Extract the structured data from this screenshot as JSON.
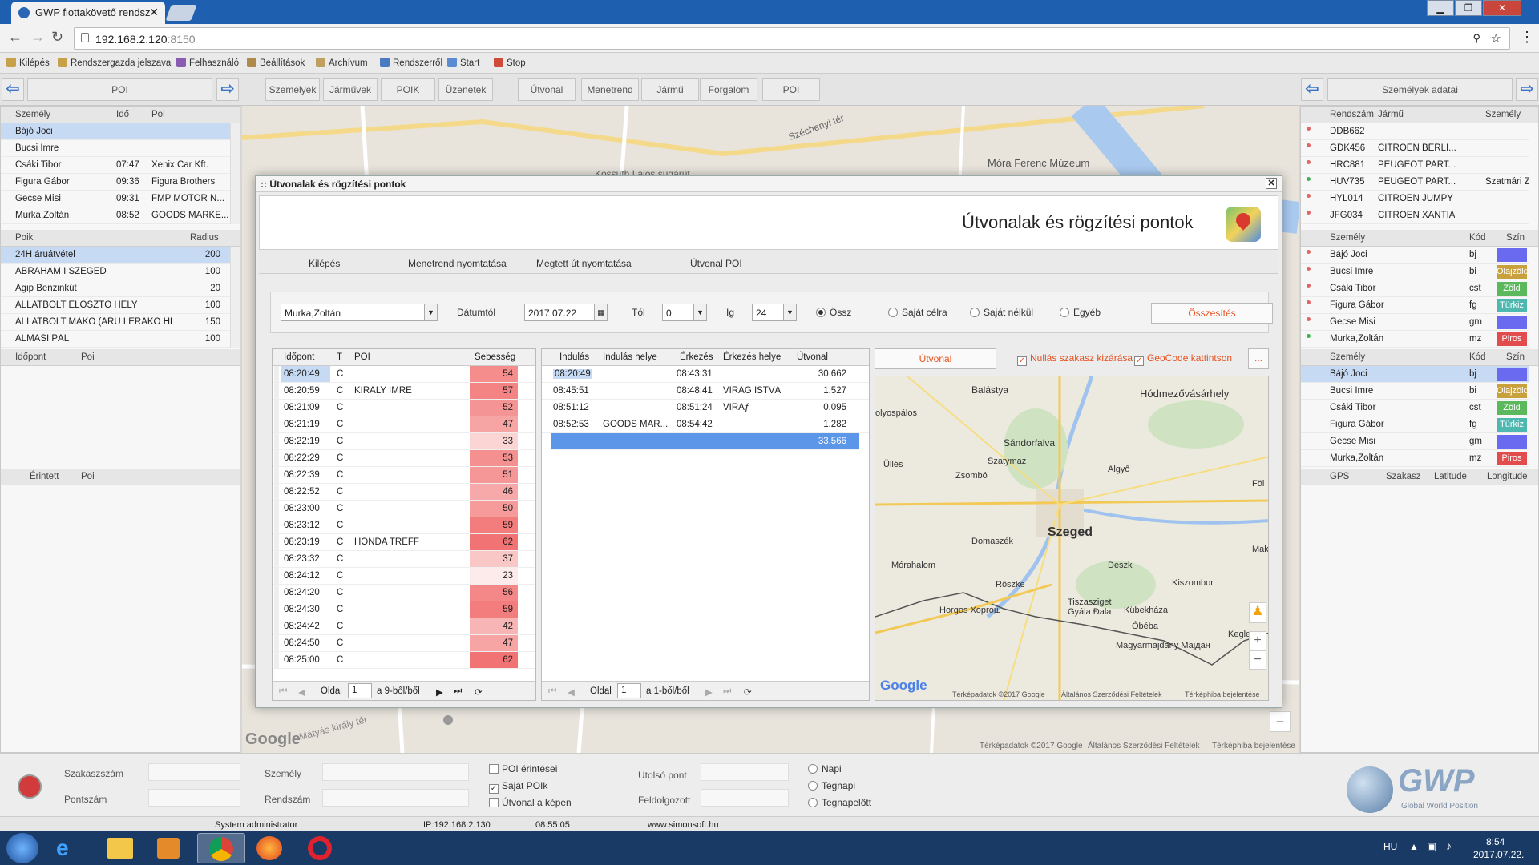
{
  "browser": {
    "tab_title": "GWP flottakövető rendsz",
    "url_host": "192.168.2.120",
    "url_port": ":8150"
  },
  "toolbar": [
    "Kilépés",
    "Rendszergazda jelszava",
    "Felhasználó",
    "Beállítások",
    "Archívum",
    "Rendszerről",
    "Start",
    "Stop"
  ],
  "nav": {
    "left_panel": "POI",
    "right_panel": "Személyek adatai",
    "buttons": [
      "Személyek",
      "Járművek",
      "POIK",
      "Üzenetek",
      "Útvonal",
      "Menetrend",
      "Jármű",
      "Forgalom",
      "POI"
    ]
  },
  "left": {
    "persons_header": [
      "Személy",
      "Idő",
      "Poi"
    ],
    "persons": [
      [
        "Bájó Joci",
        "",
        ""
      ],
      [
        "Bucsi Imre",
        "",
        ""
      ],
      [
        "Csáki Tibor",
        "07:47",
        "Xenix Car Kft."
      ],
      [
        "Figura Gábor",
        "09:36",
        "Figura Brothers"
      ],
      [
        "Gecse Misi",
        "09:31",
        "FMP MOTOR N..."
      ],
      [
        "Murka,Zoltán",
        "08:52",
        "GOODS MARKE..."
      ]
    ],
    "poik_header": [
      "Poik",
      "Radius"
    ],
    "poik": [
      [
        "24H áruátvétel",
        "200"
      ],
      [
        "ÁBRAHÁM I SZEGED",
        "100"
      ],
      [
        "Agip Benzinkút",
        "20"
      ],
      [
        "ÁLLATBOLT ELOSZTÓ HELY",
        "100"
      ],
      [
        "ÁLLATBOLT MAKÓ (ÁRU LERAKÓ HEL",
        "150"
      ],
      [
        "ALMÁSI PÁL",
        "100"
      ]
    ],
    "time_header": [
      "Időpont",
      "Poi"
    ],
    "touched_header": [
      "Érintett",
      "Poi"
    ]
  },
  "right": {
    "vehicles_header": [
      "Rendszám",
      "Jármű",
      "Személy"
    ],
    "vehicles": [
      [
        "DDB662",
        "",
        ""
      ],
      [
        "GDK456",
        "CITROEN BERLI...",
        ""
      ],
      [
        "HRC881",
        "PEUGEOT PART...",
        ""
      ],
      [
        "HUV735",
        "PEUGEOT PART...",
        "Szatmári Zita"
      ],
      [
        "HYL014",
        "CITROEN JUMPY",
        ""
      ],
      [
        "JFG034",
        "CITROEN XANTIA",
        ""
      ]
    ],
    "vehicle_dots": [
      "#e06666",
      "#e06666",
      "#e06666",
      "#43b054",
      "#e06666",
      "#e06666"
    ],
    "people_header": [
      "Személy",
      "Kód",
      "Szín"
    ],
    "people1": [
      [
        "Bájó Joci",
        "bj",
        ""
      ],
      [
        "Bucsi Imre",
        "bi",
        "Olajzöld"
      ],
      [
        "Csáki Tibor",
        "cst",
        "Zöld"
      ],
      [
        "Figura Gábor",
        "fg",
        "Türkiz"
      ],
      [
        "Gecse Misi",
        "gm",
        ""
      ],
      [
        "Murka,Zoltán",
        "mz",
        "Piros"
      ]
    ],
    "people1_colors": [
      "#6a6af0",
      "#c8a03c",
      "#5cb85c",
      "#4cb8b0",
      "#6a6af0",
      "#e24c4c"
    ],
    "people1_dots": [
      "#e06666",
      "#e06666",
      "#e06666",
      "#e06666",
      "#e06666",
      "#43b054"
    ],
    "people2": [
      [
        "Bájó Joci",
        "bj",
        ""
      ],
      [
        "Bucsi Imre",
        "bi",
        "Olajzöld"
      ],
      [
        "Csáki Tibor",
        "cst",
        "Zöld"
      ],
      [
        "Figura Gábor",
        "fg",
        "Türkiz"
      ],
      [
        "Gecse Misi",
        "gm",
        ""
      ],
      [
        "Murka,Zoltán",
        "mz",
        "Piros"
      ]
    ],
    "gps_header": [
      "GPS",
      "Szakasz",
      "Latitude",
      "Longitude"
    ]
  },
  "dialog": {
    "title": ":: Útvonalak és rögzítési pontok",
    "heading": "Útvonalak és rögzítési pontok",
    "menu": [
      "Kilépés",
      "Menetrend nyomtatása",
      "Megtett út nyomtatása",
      "Útvonal POI"
    ],
    "person_select": "Murka,Zoltán",
    "date_label": "Dátumtól",
    "date_value": "2017.07.22",
    "from_label": "Tól",
    "from_value": "0",
    "to_label": "Ig",
    "to_value": "24",
    "radios": [
      "Össz",
      "Saját célra",
      "Saját nélkül",
      "Egyéb"
    ],
    "summary_button": "Összesítés",
    "route_button": "Útvonal",
    "checkbox1": "Nullás szakasz kizárása",
    "checkbox2": "GeoCode kattintson",
    "more_button": "...",
    "points_header": [
      "Időpont",
      "T",
      "POI",
      "Sebesség"
    ],
    "points": [
      [
        "08:20:49",
        "C",
        "",
        54
      ],
      [
        "08:20:59",
        "C",
        "KIRÁLY IMRE",
        57
      ],
      [
        "08:21:09",
        "C",
        "",
        52
      ],
      [
        "08:21:19",
        "C",
        "",
        47
      ],
      [
        "08:22:19",
        "C",
        "",
        33
      ],
      [
        "08:22:29",
        "C",
        "",
        53
      ],
      [
        "08:22:39",
        "C",
        "",
        51
      ],
      [
        "08:22:52",
        "C",
        "",
        46
      ],
      [
        "08:23:00",
        "C",
        "",
        50
      ],
      [
        "08:23:12",
        "C",
        "",
        59
      ],
      [
        "08:23:19",
        "C",
        "HONDA TREFF",
        62
      ],
      [
        "08:23:32",
        "C",
        "",
        37
      ],
      [
        "08:24:12",
        "C",
        "",
        23
      ],
      [
        "08:24:20",
        "C",
        "",
        56
      ],
      [
        "08:24:30",
        "C",
        "",
        59
      ],
      [
        "08:24:42",
        "C",
        "",
        42
      ],
      [
        "08:24:50",
        "C",
        "",
        47
      ],
      [
        "08:25:00",
        "C",
        "",
        62
      ]
    ],
    "pager1": {
      "label": "Oldal",
      "page": "1",
      "of": "a 9-ből/ből"
    },
    "trips_header": [
      "Indulás",
      "Indulás helye",
      "Érkezés",
      "Érkezés helye",
      "Útvonal"
    ],
    "trips": [
      [
        "08:20:49",
        "",
        "08:43:31",
        "",
        "30.662"
      ],
      [
        "08:45:51",
        "",
        "08:48:41",
        "VIRÁG ISTVÁ...",
        "1.527"
      ],
      [
        "08:51:12",
        "",
        "08:51:24",
        "VIRÃƒ",
        "0.095"
      ],
      [
        "08:52:53",
        "GOODS MAR...",
        "08:54:42",
        "",
        "1.282"
      ]
    ],
    "trips_total": "33.566",
    "pager2": {
      "label": "Oldal",
      "page": "1",
      "of": "a 1-ből/ből"
    }
  },
  "map": {
    "cities": [
      {
        "name": "Hódmezővásárhely"
      },
      {
        "name": "Balástya"
      },
      {
        "name": "Sándorfalva"
      },
      {
        "name": "Szatymaz"
      },
      {
        "name": "Algyő"
      },
      {
        "name": "Zsombó"
      },
      {
        "name": "Üllés"
      },
      {
        "name": "Szeged"
      },
      {
        "name": "Domaszék"
      },
      {
        "name": "Mórahalom"
      },
      {
        "name": "Deszk"
      },
      {
        "name": "Röszke"
      },
      {
        "name": "Kiszombor"
      },
      {
        "name": "Tiszasziget"
      },
      {
        "name": "Horgos Хоргош"
      },
      {
        "name": "Gyála Đala"
      },
      {
        "name": "Kübekháza"
      },
      {
        "name": "Óbéba"
      },
      {
        "name": "Keglev"
      },
      {
        "name": "Magyarmajdány Мајдан"
      },
      {
        "name": "olyospálos"
      },
      {
        "name": "Föl"
      },
      {
        "name": "Mak"
      }
    ],
    "footer": [
      "Térképadatok ©2017 Google",
      "Általános Szerződési Feltételek",
      "Térképhiba bejelentése"
    ],
    "google": "Google",
    "bg_labels": [
      "Móra Ferenc Múzeum",
      "Kossuth Lajos sugárút",
      "Széchenyi tér",
      "Mátyás király tér"
    ]
  },
  "bottom": {
    "labels": {
      "szakaszszam": "Szakaszszám",
      "pontszam": "Pontszám",
      "szemely": "Személy",
      "rendszam": "Rendszám",
      "utolso": "Utolsó pont",
      "feldolgozott": "Feldolgozott"
    },
    "checks": [
      "POI érintései",
      "Saját POIk",
      "Útvonal a képen"
    ],
    "checks_on": [
      false,
      true,
      false
    ],
    "radios": [
      "Napi",
      "Tegnapi",
      "Tegnapelőtt"
    ],
    "status": [
      "System administrator",
      "IP:192.168.2.130",
      "08:55:05",
      "www.simonsoft.hu"
    ],
    "logo": "GWP",
    "logo_sub": "Global World Position"
  },
  "taskbar": {
    "lang": "HU",
    "time": "8:54",
    "date": "2017.07.22."
  }
}
